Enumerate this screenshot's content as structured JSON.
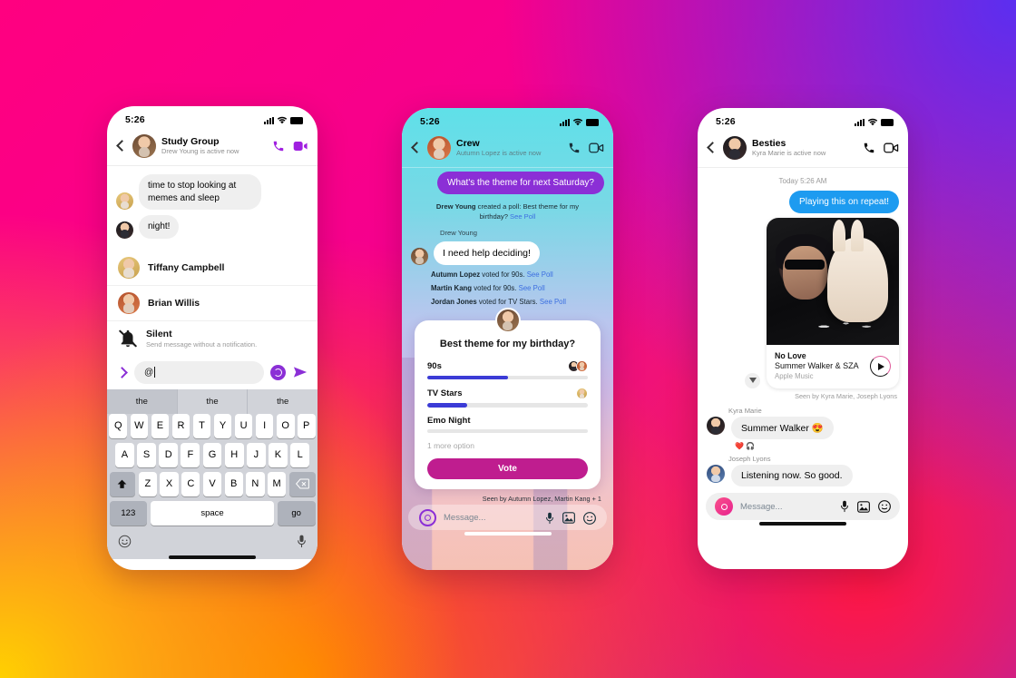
{
  "background": {
    "colors": [
      "#ff0080",
      "#5b2ef0",
      "#ffd000",
      "#ff6a00"
    ]
  },
  "phones": {
    "left": {
      "status": {
        "time": "5:26"
      },
      "header": {
        "name": "Study Group",
        "subtitle": "Drew Young is active now",
        "call_icon": "phone-icon",
        "video_icon": "video-camera-icon",
        "back_icon": "chevron-left-icon"
      },
      "messages": [
        {
          "text": "time to stop looking at memes and sleep"
        },
        {
          "text": "night!"
        }
      ],
      "mention_list": [
        {
          "name": "Tiffany Campbell"
        },
        {
          "name": "Brian Willis"
        }
      ],
      "silent": {
        "title": "Silent",
        "subtitle": "Send message without a notification.",
        "icon": "bell-slash-icon"
      },
      "composer": {
        "value": "@",
        "expand_icon": "chevron-right-icon",
        "ig_icon": "instagram-ring-icon",
        "send_icon": "send-arrow-icon"
      },
      "keyboard": {
        "predictions": [
          "the",
          "the",
          "the"
        ],
        "row1": [
          "Q",
          "W",
          "E",
          "R",
          "T",
          "Y",
          "U",
          "I",
          "O",
          "P"
        ],
        "row2": [
          "A",
          "S",
          "D",
          "F",
          "G",
          "H",
          "J",
          "K",
          "L"
        ],
        "row3": [
          "Z",
          "X",
          "C",
          "V",
          "B",
          "N",
          "M"
        ],
        "shift": "shift-icon",
        "backspace": "backspace-icon",
        "numbers": "123",
        "space": "space",
        "enter": "go",
        "emoji_icon": "emoji-icon",
        "mic_icon": "microphone-icon"
      }
    },
    "middle": {
      "status": {
        "time": "5:26"
      },
      "header": {
        "name": "Crew",
        "subtitle": "Autumn Lopez is active now",
        "call_icon": "phone-icon",
        "video_icon": "video-camera-icon",
        "back_icon": "chevron-left-icon"
      },
      "outgoing": "What's the theme for next Saturday?",
      "poll_created": {
        "actor": "Drew Young",
        "text": " created a poll: Best theme for my birthday? ",
        "link": "See Poll"
      },
      "sender_label": "Drew Young",
      "incoming": "I need help deciding!",
      "votes": [
        {
          "actor": "Autumn Lopez",
          "text": " voted for 90s. ",
          "link": "See Poll"
        },
        {
          "actor": "Martin Kang",
          "text": " voted for 90s. ",
          "link": "See Poll"
        },
        {
          "actor": "Jordan Jones",
          "text": " voted for TV Stars. ",
          "link": "See Poll"
        }
      ],
      "poll": {
        "question": "Best theme for my birthday?",
        "options": [
          {
            "label": "90s",
            "percent": 50,
            "voters": 2
          },
          {
            "label": "TV Stars",
            "percent": 25,
            "voters": 1
          },
          {
            "label": "Emo Night",
            "percent": 0,
            "voters": 0
          }
        ],
        "more_option": "1 more option",
        "vote_button": "Vote",
        "fill_color": "#3b3bd6",
        "button_color": "#bf1d8f"
      },
      "seen": "Seen by Autumn Lopez, Martin Kang + 1",
      "composer": {
        "placeholder": "Message...",
        "camera_icon": "instagram-camera-icon",
        "mic_icon": "microphone-icon",
        "gallery_icon": "image-icon",
        "sticker_icon": "sticker-icon"
      }
    },
    "right": {
      "status": {
        "time": "5:26"
      },
      "header": {
        "name": "Besties",
        "subtitle": "Kyra Marie is active now",
        "call_icon": "phone-icon",
        "video_icon": "video-camera-icon",
        "back_icon": "chevron-left-icon"
      },
      "date_divider": "Today 5:26 AM",
      "outgoing": "Playing this on repeat!",
      "music": {
        "title": "No Love",
        "artist": "Summer Walker & SZA",
        "source": "Apple Music",
        "play_icon": "play-icon",
        "reply_icon": "reply-icon"
      },
      "seen": "Seen by Kyra Marie, Joseph Lyons",
      "messages": [
        {
          "sender": "Kyra Marie",
          "text": "Summer Walker 😍",
          "reactions": [
            "❤️",
            "🎧"
          ]
        },
        {
          "sender": "Joseph Lyons",
          "text": "Listening now. So good.",
          "reactions": []
        }
      ],
      "composer": {
        "placeholder": "Message...",
        "camera_icon": "instagram-camera-icon",
        "mic_icon": "microphone-icon",
        "gallery_icon": "image-icon",
        "sticker_icon": "sticker-icon"
      }
    }
  }
}
